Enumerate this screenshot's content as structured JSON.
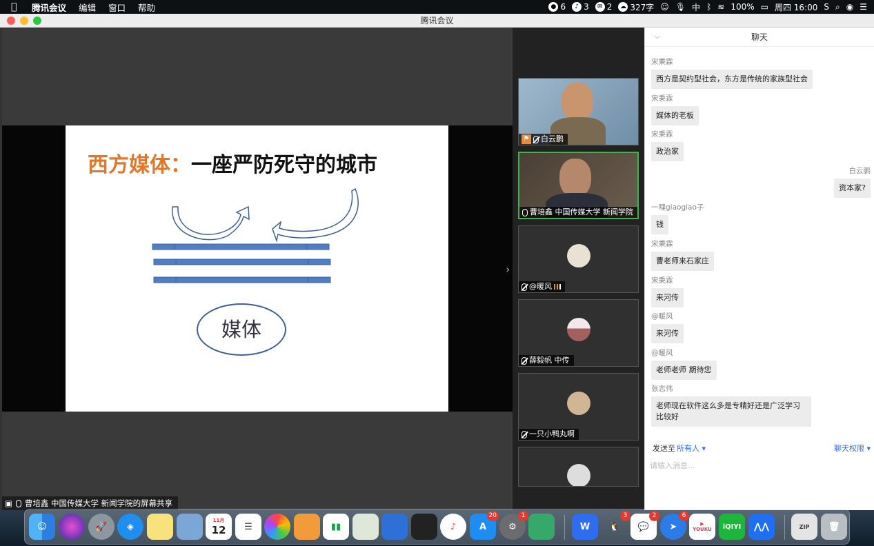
{
  "menubar": {
    "app": "腾讯会议",
    "menus": [
      "编辑",
      "窗口",
      "帮助"
    ],
    "status": {
      "item1": "6",
      "item2": "3",
      "item3": "2",
      "word_count": "327字",
      "ime": "中",
      "battery": "100%",
      "datetime": "周四 16:00"
    }
  },
  "window": {
    "title": "腾讯会议"
  },
  "slide": {
    "title_orange": "西方媒体：",
    "title_black": "一座严防死守的城市",
    "ellipse_text": "媒体"
  },
  "share_label": "曹培鑫 中国传媒大学 新闻学院的屏幕共享",
  "participants": [
    {
      "name": "白云鹏"
    },
    {
      "name": "曹培鑫 中国传媒大学 新闻学院"
    },
    {
      "name": "@暖风"
    },
    {
      "name": "薛毅帆 中传"
    },
    {
      "name": "一只小鸭丸啊"
    },
    {
      "name": ""
    }
  ],
  "chat": {
    "title": "聊天",
    "messages": [
      {
        "sender": "宋秉霖",
        "text": "西方是契约型社会，东方是传统的家族型社会"
      },
      {
        "sender": "宋秉霖",
        "text": "媒体的老板"
      },
      {
        "sender": "宋秉霖",
        "text": "政治家"
      },
      {
        "sender": "白云鹏",
        "text": "资本家?"
      },
      {
        "sender": "一哩giaogiao子",
        "text": "钱"
      },
      {
        "sender": "宋秉霖",
        "text": "曹老师来石家庄"
      },
      {
        "sender": "宋秉霖",
        "text": "来河传"
      },
      {
        "sender": "@暖风",
        "text": "来河传"
      },
      {
        "sender": "@暖风",
        "text": "老师老师 期待您"
      },
      {
        "sender": "张志伟",
        "text": "老师现在软件这么多是专精好还是广泛学习比较好"
      }
    ],
    "send_to_label": "发送至",
    "send_to_value": "所有人",
    "permission": "聊天权限",
    "placeholder": "请输入消息..."
  },
  "dock": {
    "calendar_day": "12",
    "calendar_month": "11月",
    "badges": {
      "appstore": "20",
      "settings": "1",
      "qq": "3",
      "wechat": "2",
      "feishu": "6"
    },
    "youku": "YOUKU",
    "iqiyi": "iQIYI"
  }
}
